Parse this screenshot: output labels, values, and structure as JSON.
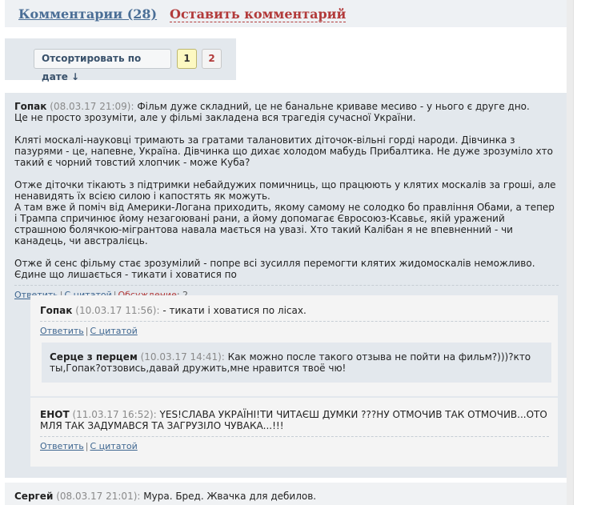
{
  "tabs": {
    "comments": "Комментарии (28)",
    "leave_comment": "Оставить комментарий"
  },
  "toolbar": {
    "sort_label": "Отсортировать по дате ↓",
    "pages": [
      "1",
      "2"
    ],
    "current_page": "1"
  },
  "comments": [
    {
      "author": "Гопак",
      "date": "(08.03.17 21:09):",
      "paragraphs": [
        "Фільм дуже складний, це не банальне криваве месиво - у нього є друге дно.\nЦе не просто зрозуміти, але у фільмі закладена вся трагедія сучасної України.",
        "Кляті москалі-науковці тримають за гратами талановитих діточок-вільні горді народи. Дівчинка з пазурями - це, напевне, Україна. Дівчинка що дихає холодом мабудь Прибалтика. Не дуже зрозуміло хто такий є чорний товстий хлопчик - може Куба?",
        "Отже діточки тікають з підтримки небайдужих помичниць, що працюють у клятих москалів за гроші, але ненавидять їх всією силою і капостять як можуть.\nА там вже й поміч від Америки-Логана приходить, якому самому не солодко бо правління Обами, а тепер і Трампа спричинює йому незагоювані рани, а йому допомагає Євросоюз-Ксавьє, якій уражений страшною болячкою-мігрантова навала мається на увазі. Хто такий Калібан я не впевненний - чи канадець, чи австралієць.",
        "Отже й сенс фільму стає зрозумілий - попре всі зусилля перемогти клятих жидомоскалів неможливо. Єдине що лишається - тикати і ховатися по"
      ],
      "actions": {
        "reply": "Ответить",
        "quote": "С цитатой",
        "discussion": "Обсуждение",
        "discussion_count": ": 2"
      }
    },
    {
      "author": "Гопак",
      "date": "(10.03.17 11:56):",
      "text": "- тикати і ховатися по лісах.",
      "actions": {
        "reply": "Ответить",
        "quote": "С цитатой"
      }
    },
    {
      "author": "Серце з перцем",
      "date": "(10.03.17 14:41):",
      "text": "Как можно после такого отзыва не пойти на фильм?)))?кто ты,Гопак?отзовись,давай дружить,мне нравится твоё чю!"
    },
    {
      "author": "ЕНОТ",
      "date": "(11.03.17 16:52):",
      "text": "YES!СЛАВА УКРАЇНІ!ТИ ЧИТАЄШ ДУМКИ ???НУ ОТМОЧИВ ТАК ОТМОЧИВ...ОТО МЛЯ ТАК ЗАДУМАВСЯ ТА ЗАГРУЗІЛО ЧУВАКА...!!!",
      "actions": {
        "reply": "Ответить",
        "quote": "С цитатой"
      }
    },
    {
      "author": "Сергей",
      "date": "(08.03.17 21:01):",
      "text": "Мура. Бред. Жвачка для дебилов."
    }
  ]
}
